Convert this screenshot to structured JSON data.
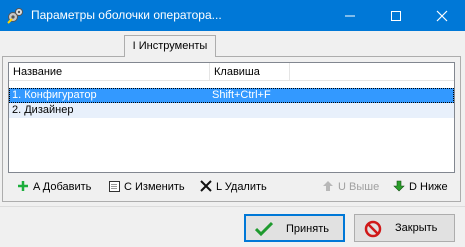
{
  "window": {
    "title": "Параметры оболочки оператора...",
    "buttons": {
      "minimize": "minimize-icon",
      "maximize": "maximize-icon",
      "close": "close-icon"
    }
  },
  "tab": {
    "label": "I Инструменты"
  },
  "list": {
    "columns": [
      "Название",
      "Клавиша"
    ],
    "rows": [
      {
        "name": "1. Конфигуратор",
        "key": "Shift+Ctrl+F",
        "selected": true
      },
      {
        "name": "2. Дизайнер",
        "key": "",
        "selected": false
      }
    ]
  },
  "toolbar": {
    "add": {
      "label": "A Добавить",
      "icon": "plus-icon",
      "enabled": true
    },
    "edit": {
      "label": "C Изменить",
      "icon": "edit-icon",
      "enabled": true
    },
    "delete": {
      "label": "L Удалить",
      "icon": "delete-x-icon",
      "enabled": true
    },
    "up": {
      "label": "U Выше",
      "icon": "arrow-up-icon",
      "enabled": false
    },
    "down": {
      "label": "D Ниже",
      "icon": "arrow-down-icon",
      "enabled": true
    }
  },
  "dialog_buttons": {
    "ok": {
      "label": "Принять",
      "icon": "checkmark-icon"
    },
    "close": {
      "label": "Закрыть",
      "icon": "no-entry-icon"
    }
  },
  "colors": {
    "titlebar": "#0078d7",
    "selection": "#3399ff",
    "alt_row": "#e8f0fb",
    "add_icon": "#1cae3c",
    "down_icon": "#2a9d2a",
    "checkmark": "#1f9a2f",
    "no_entry": "#d01919"
  }
}
